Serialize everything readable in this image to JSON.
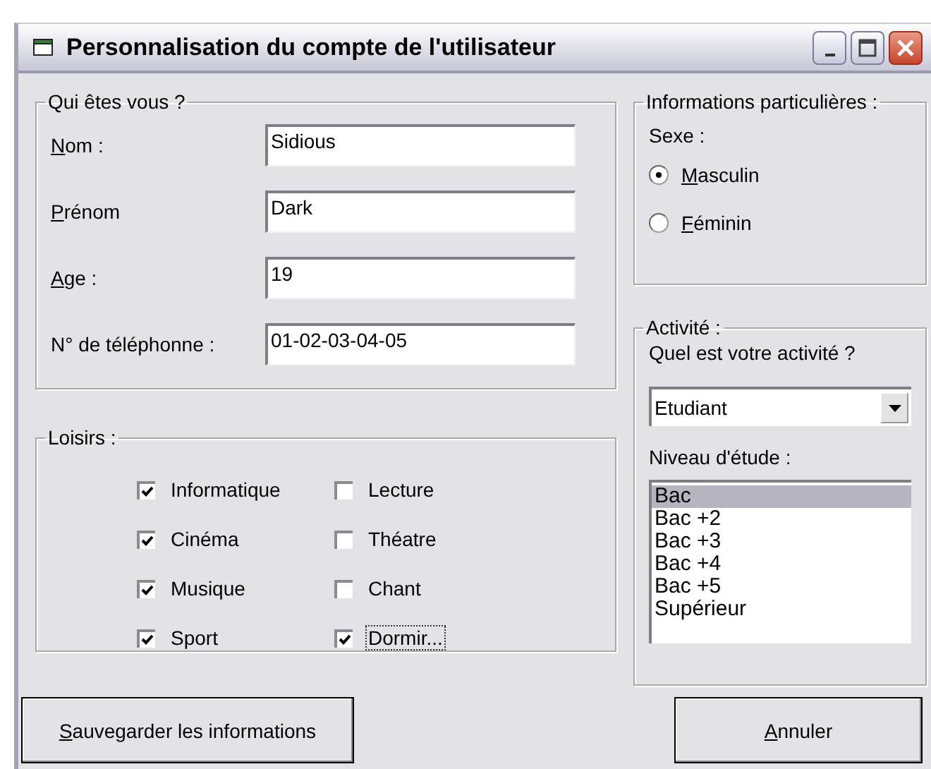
{
  "window": {
    "title": "Personnalisation du compte de l'utilisateur"
  },
  "identity": {
    "legend": "Qui êtes vous ?",
    "fields": [
      {
        "label": "Nom :",
        "mnemonic": true,
        "value": "Sidious"
      },
      {
        "label": "Prénom",
        "mnemonic": true,
        "value": "Dark"
      },
      {
        "label": "Age :",
        "mnemonic": true,
        "value": "19"
      },
      {
        "label": "N° de téléphonne :",
        "mnemonic": false,
        "value": "01-02-03-04-05"
      }
    ]
  },
  "hobbies": {
    "legend": "Loisirs :",
    "items": [
      {
        "label": "Informatique",
        "checked": true,
        "focused": false
      },
      {
        "label": "Lecture",
        "checked": false,
        "focused": false
      },
      {
        "label": "Cinéma",
        "checked": true,
        "focused": false
      },
      {
        "label": "Théatre",
        "checked": false,
        "focused": false
      },
      {
        "label": "Musique",
        "checked": true,
        "focused": false
      },
      {
        "label": "Chant",
        "checked": false,
        "focused": false
      },
      {
        "label": "Sport",
        "checked": true,
        "focused": false
      },
      {
        "label": "Dormir...",
        "checked": true,
        "focused": true
      }
    ]
  },
  "info": {
    "legend": "Informations particulières :",
    "sex_label": "Sexe :",
    "options": [
      {
        "label": "Masculin",
        "mnemonic": true,
        "selected": true
      },
      {
        "label": "Féminin",
        "mnemonic": true,
        "selected": false
      }
    ]
  },
  "activity": {
    "legend": "Activité :",
    "question": "Quel est votre activité ?",
    "dropdown": {
      "value": "Etudiant"
    },
    "level_label": "Niveau d'étude :",
    "levels": [
      {
        "label": "Bac",
        "selected": true
      },
      {
        "label": "Bac +2",
        "selected": false
      },
      {
        "label": "Bac +3",
        "selected": false
      },
      {
        "label": "Bac +4",
        "selected": false
      },
      {
        "label": "Bac +5",
        "selected": false
      },
      {
        "label": "Supérieur",
        "selected": false
      }
    ]
  },
  "buttons": [
    {
      "label": "Sauvegarder les informations",
      "mnemonic": true,
      "kind": "save"
    },
    {
      "label": "Annuler",
      "mnemonic": true,
      "kind": "cancel"
    }
  ]
}
